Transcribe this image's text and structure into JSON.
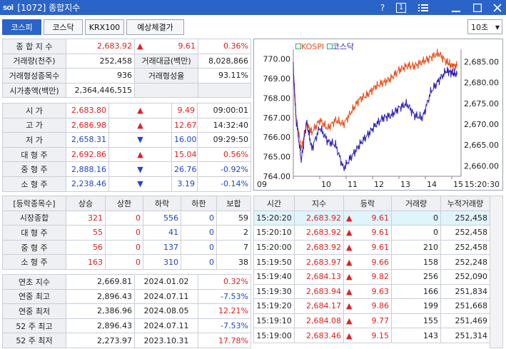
{
  "window": {
    "title": "[1072] 종합지수",
    "logo": "sol",
    "help": "?",
    "page_num": "1"
  },
  "tabs": [
    {
      "label": "코스피"
    },
    {
      "label": "코스닥"
    },
    {
      "label": "KRX100"
    },
    {
      "label": "예상체결가"
    }
  ],
  "interval": "10초",
  "summary": {
    "r1": {
      "label": "종 합 지 수",
      "value": "2,683.92",
      "change": "9.61",
      "rate": "0.36%"
    },
    "r2": {
      "label": "거래량(천주)",
      "value": "252,458",
      "label2": "거래대금(백만)",
      "value2": "8,028,866"
    },
    "r3": {
      "label": "거래형성종목수",
      "value": "936",
      "label2": "거래형성율",
      "value2": "93.11%"
    },
    "r4": {
      "label": "시가총액(백만)",
      "value": "2,364,446,515"
    }
  },
  "prices": [
    {
      "label": "시     가",
      "value": "2,683.80",
      "change": "9.49",
      "extra": "09:00:01",
      "dir": "up"
    },
    {
      "label": "고     가",
      "value": "2,686.98",
      "change": "12.67",
      "extra": "14:32:40",
      "dir": "up"
    },
    {
      "label": "저     가",
      "value": "2,658.31",
      "change": "16.00",
      "extra": "09:29:50",
      "dir": "down"
    },
    {
      "label": "대 형 주",
      "value": "2,692.86",
      "change": "15.04",
      "extra": "0.56%",
      "dir": "up"
    },
    {
      "label": "중 형 주",
      "value": "2,888.16",
      "change": "26.76",
      "extra": "-0.92%",
      "dir": "down"
    },
    {
      "label": "소 형 주",
      "value": "2,238.46",
      "change": "3.19",
      "extra": "-0.14%",
      "dir": "down"
    }
  ],
  "breadth": {
    "headers": [
      "[등락종목수]",
      "상승",
      "상한",
      "하락",
      "하한",
      "보합"
    ],
    "rows": [
      {
        "label": "시장종합",
        "up": "321",
        "uplim": "0",
        "down": "556",
        "downlim": "0",
        "flat": "59"
      },
      {
        "label": "대 형 주",
        "up": "55",
        "uplim": "0",
        "down": "41",
        "downlim": "0",
        "flat": "2"
      },
      {
        "label": "중 형 주",
        "up": "56",
        "uplim": "0",
        "down": "137",
        "downlim": "0",
        "flat": "7"
      },
      {
        "label": "소 형 주",
        "up": "163",
        "uplim": "0",
        "down": "310",
        "downlim": "0",
        "flat": "38"
      }
    ]
  },
  "yearly": [
    {
      "label": "연초  지수",
      "value": "2,669.81",
      "date": "2024.01.02",
      "rate": "0.32%",
      "dir": "up"
    },
    {
      "label": "연중  최고",
      "value": "2,896.43",
      "date": "2024.07.11",
      "rate": "-7.53%",
      "dir": "down"
    },
    {
      "label": "연중  최저",
      "value": "2,386.96",
      "date": "2024.08.05",
      "rate": "12.21%",
      "dir": "up"
    },
    {
      "label": "52 주 최고",
      "value": "2,896.43",
      "date": "2024.07.11",
      "rate": "-7.53%",
      "dir": "down"
    },
    {
      "label": "52 주 최저",
      "value": "2,273.97",
      "date": "2023.10.31",
      "rate": "17.78%",
      "dir": "up"
    }
  ],
  "ticks": {
    "headers": [
      "시간",
      "지수",
      "등락",
      "거래량",
      "누적거래량"
    ],
    "rows": [
      {
        "time": "15:20:20",
        "index": "2,683.92",
        "change": "9.61",
        "vol": "0",
        "cum": "252,458"
      },
      {
        "time": "15:20:10",
        "index": "2,683.92",
        "change": "9.61",
        "vol": "0",
        "cum": "252,458"
      },
      {
        "time": "15:20:00",
        "index": "2,683.92",
        "change": "9.61",
        "vol": "210",
        "cum": "252,458"
      },
      {
        "time": "15:19:50",
        "index": "2,683.97",
        "change": "9.66",
        "vol": "158",
        "cum": "252,248"
      },
      {
        "time": "15:19:40",
        "index": "2,684.13",
        "change": "9.82",
        "vol": "256",
        "cum": "252,090"
      },
      {
        "time": "15:19:30",
        "index": "2,683.94",
        "change": "9.63",
        "vol": "166",
        "cum": "251,834"
      },
      {
        "time": "15:19:20",
        "index": "2,684.17",
        "change": "9.86",
        "vol": "199",
        "cum": "251,668"
      },
      {
        "time": "15:19:10",
        "index": "2,684.08",
        "change": "9.77",
        "vol": "155",
        "cum": "251,469"
      },
      {
        "time": "15:19:00",
        "index": "2,683.46",
        "change": "9.15",
        "vol": "143",
        "cum": "251,314"
      }
    ]
  },
  "chart_data": {
    "type": "line",
    "legend": [
      "KOSPI",
      "코스닥"
    ],
    "x_ticks": [
      "09",
      "10",
      "11",
      "12",
      "13",
      "14",
      "15"
    ],
    "time_label": "15:20:30",
    "left_axis": {
      "ticks": [
        "770.00",
        "769.00",
        "768.00",
        "767.00",
        "766.00",
        "765.00",
        "764.00"
      ],
      "range": [
        764,
        770.5
      ]
    },
    "right_axis": {
      "ticks": [
        "2,685.00",
        "2,680.00",
        "2,675.00",
        "2,670.00",
        "2,665.00",
        "2,660.00"
      ],
      "range": [
        2657.5,
        2688
      ]
    },
    "series": [
      {
        "name": "KOSPI",
        "axis": "right",
        "color": "#e8501c",
        "x": [
          9.0,
          9.1,
          9.3,
          9.5,
          9.7,
          10.0,
          10.3,
          10.6,
          10.9,
          11.2,
          11.5,
          11.8,
          12.1,
          12.4,
          12.7,
          13.0,
          13.3,
          13.6,
          13.9,
          14.2,
          14.5,
          14.8,
          15.0,
          15.2
        ],
        "y": [
          2682,
          2672,
          2664,
          2670,
          2668,
          2671,
          2669,
          2671,
          2670,
          2673,
          2676,
          2677,
          2679,
          2680,
          2681,
          2683,
          2684,
          2684,
          2685,
          2686,
          2687,
          2685,
          2684,
          2684
        ]
      },
      {
        "name": "코스닥",
        "axis": "left",
        "color": "#2a1fb8",
        "x": [
          9.0,
          9.1,
          9.3,
          9.5,
          9.7,
          10.0,
          10.3,
          10.6,
          10.9,
          11.2,
          11.5,
          11.8,
          12.1,
          12.4,
          12.7,
          13.0,
          13.3,
          13.6,
          13.9,
          14.2,
          14.5,
          14.8,
          15.0,
          15.2
        ],
        "y": [
          769.6,
          767.0,
          764.8,
          766.8,
          765.4,
          766.5,
          765.8,
          765.6,
          764.4,
          765.0,
          765.6,
          766.1,
          766.6,
          767.0,
          767.1,
          767.5,
          767.7,
          767.1,
          767.0,
          768.3,
          768.9,
          769.4,
          769.3,
          769.2
        ]
      }
    ]
  },
  "colors": {
    "accent": "#2b64c8",
    "up": "#e02020",
    "down": "#1f45c8",
    "highlight": "#dff4fb"
  }
}
